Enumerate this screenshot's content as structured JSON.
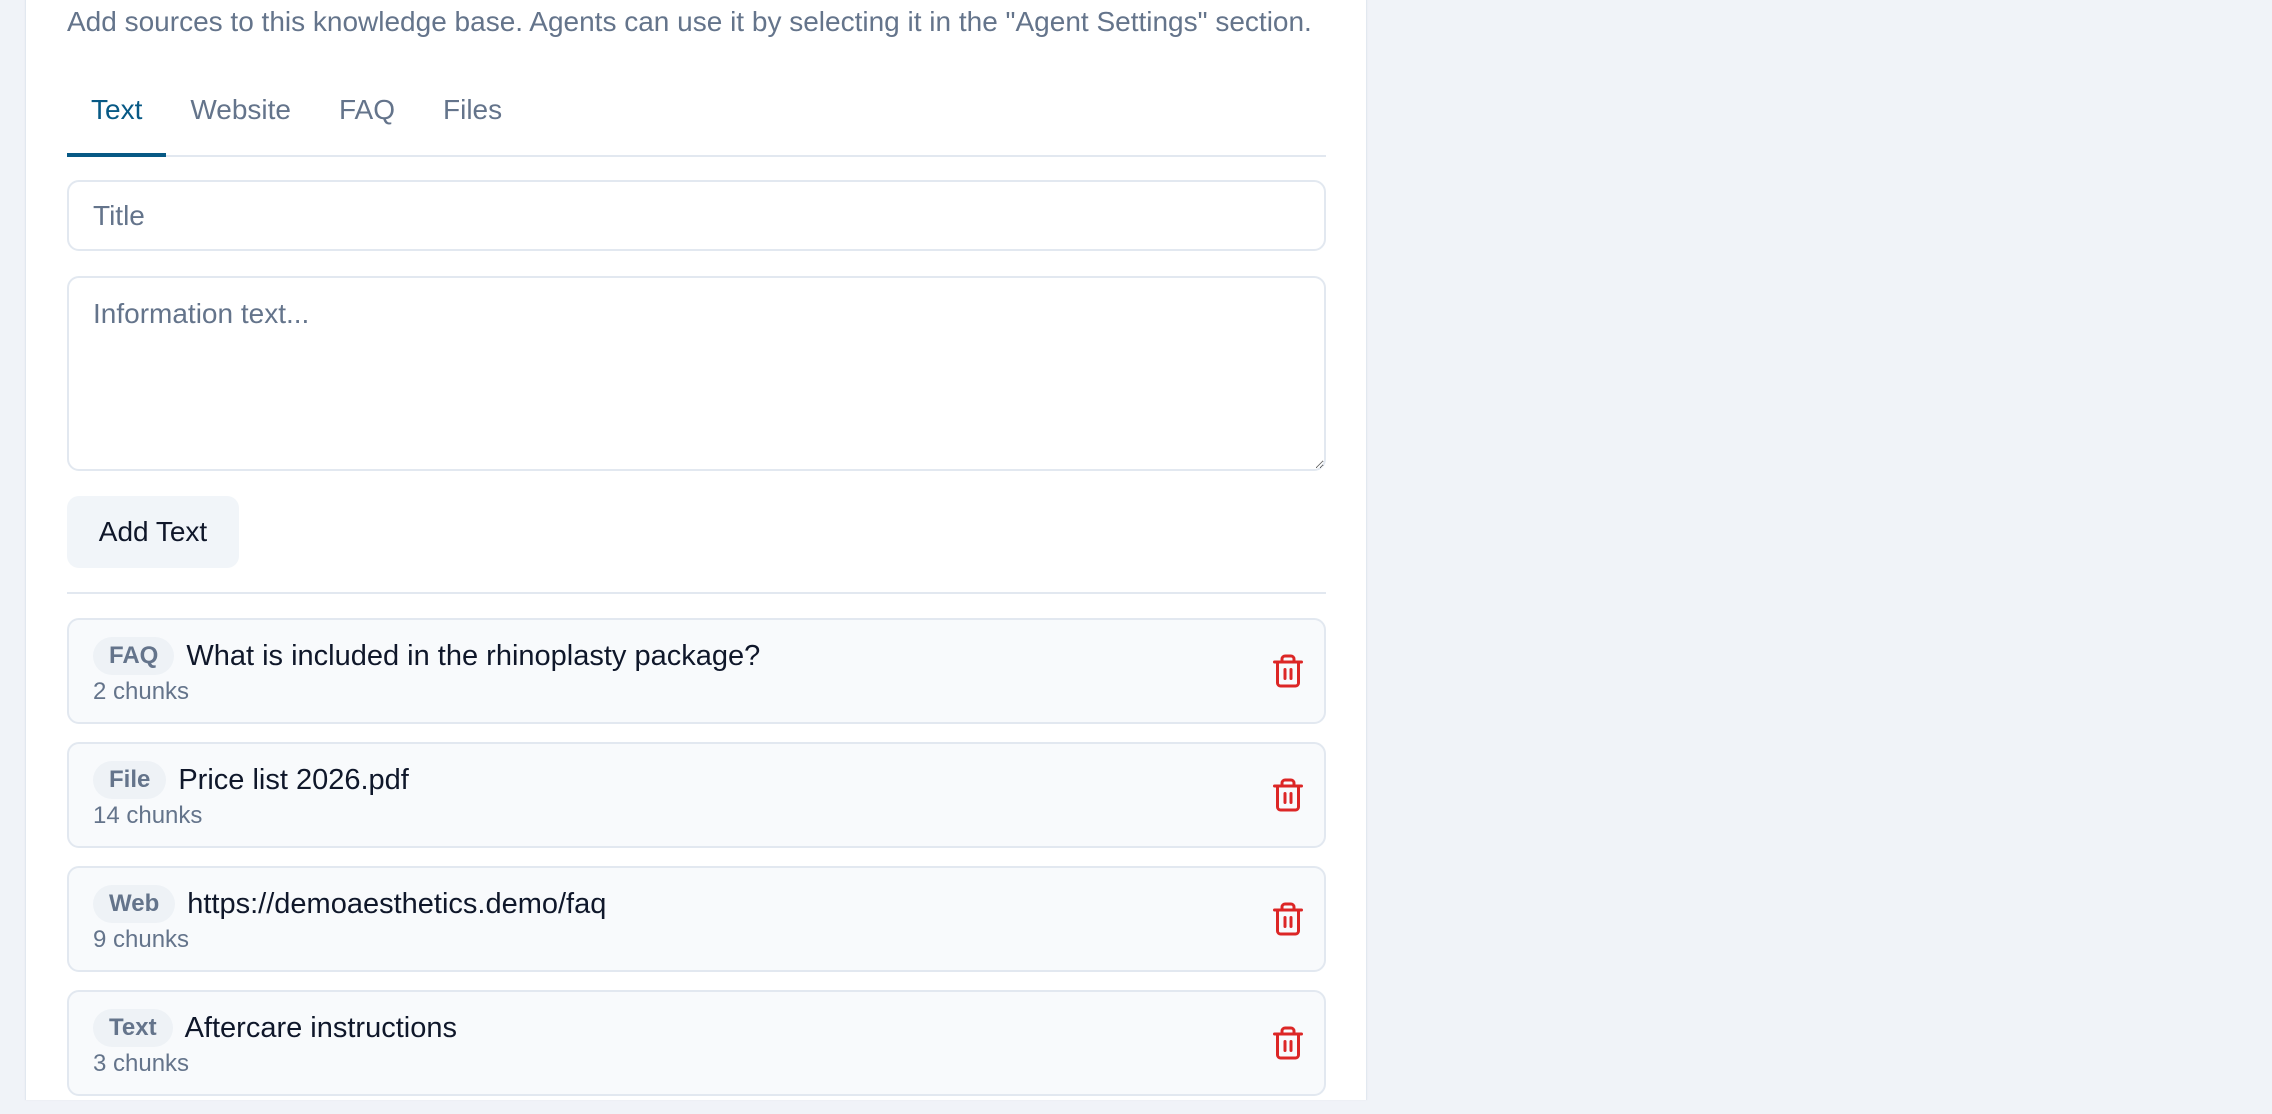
{
  "knowledge_base": {
    "description": "Add sources to this knowledge base. Agents can use it by selecting it in the \"Agent Settings\" section.",
    "tabs": [
      {
        "label": "Text",
        "active": true
      },
      {
        "label": "Website",
        "active": false
      },
      {
        "label": "FAQ",
        "active": false
      },
      {
        "label": "Files",
        "active": false
      }
    ],
    "form": {
      "title_placeholder": "Title",
      "title_value": "",
      "text_placeholder": "Information text...",
      "text_value": "",
      "add_label": "Add Text"
    },
    "sources": [
      {
        "type": "FAQ",
        "title": "What is included in the rhinoplasty package?",
        "chunks": "2 chunks"
      },
      {
        "type": "File",
        "title": "Price list 2026.pdf",
        "chunks": "14 chunks"
      },
      {
        "type": "Web",
        "title": "https://demoaesthetics.demo/faq",
        "chunks": "9 chunks"
      },
      {
        "type": "Text",
        "title": "Aftercare instructions",
        "chunks": "3 chunks"
      }
    ]
  },
  "colors": {
    "accent": "#075985",
    "danger": "#dc2626",
    "muted_text": "#64748b",
    "border": "#e2e8f0",
    "page_background": "#f0f3f8"
  },
  "icons": {
    "delete": "trash-icon"
  }
}
